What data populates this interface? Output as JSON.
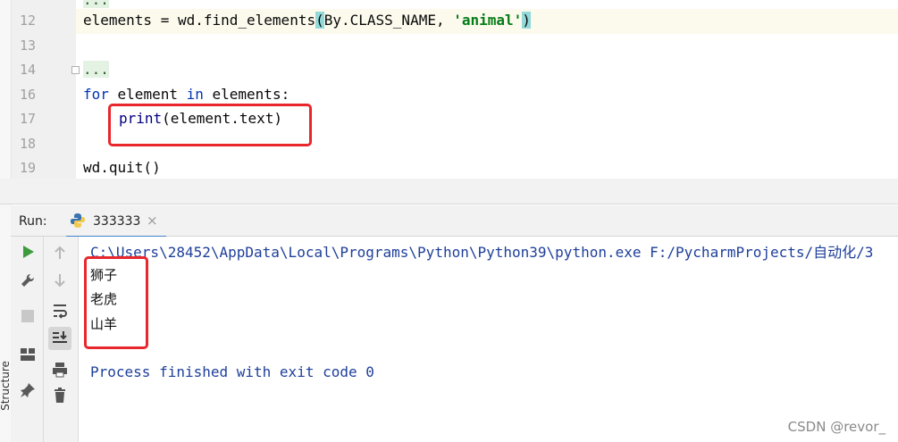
{
  "editor": {
    "lines": [
      {
        "num": "12",
        "text_a": "elements = wd.find_elements",
        "paren_open": "(",
        "text_b": "By.CLASS_NAME, ",
        "string": "'animal'",
        "paren_close": ")"
      },
      {
        "num": "13"
      },
      {
        "num": "14",
        "folded": "..."
      },
      {
        "num": "16",
        "kw_for": "for",
        "mid": " element ",
        "kw_in": "in",
        "rest": " elements:"
      },
      {
        "num": "17",
        "call": "print",
        "args": "(element.text)"
      },
      {
        "num": "18"
      },
      {
        "num": "19",
        "text": "wd.quit()"
      }
    ],
    "top_fold": "..."
  },
  "run": {
    "label": "Run:",
    "tab_name": "333333",
    "close_glyph": "×"
  },
  "console": {
    "command": "C:\\Users\\28452\\AppData\\Local\\Programs\\Python\\Python39\\python.exe F:/PycharmProjects/自动化/3",
    "outputs": [
      "狮子",
      "老虎",
      "山羊"
    ],
    "finish": "Process finished with exit code 0"
  },
  "sidebar": {
    "structure_label": "Structure"
  },
  "watermark": "CSDN @revor_"
}
